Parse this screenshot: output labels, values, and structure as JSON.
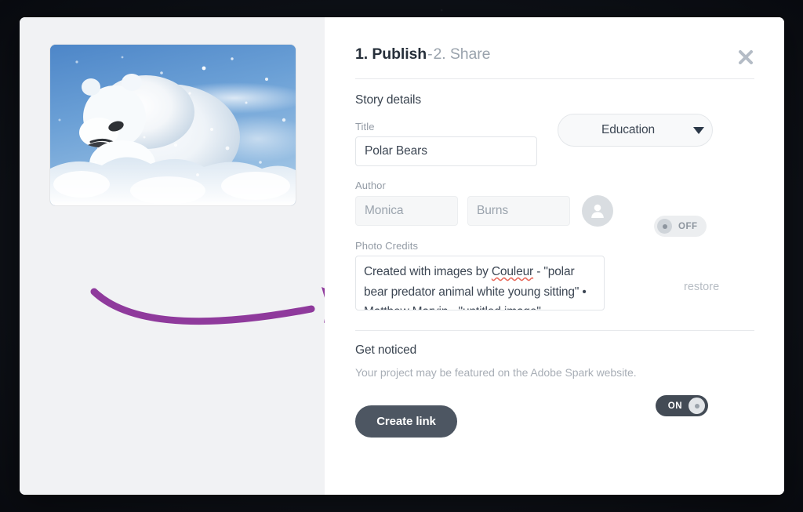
{
  "backdrop": {
    "color": "#0e1117"
  },
  "dialog": {
    "accent_purple": "#8f3a9c",
    "close_icon": "close-x-icon"
  },
  "preview": {
    "image_alt": "Polar bear cub lying in blowing snow under a blue sky",
    "annotation": {
      "type": "curved-arrow",
      "color": "#8f3a9c",
      "points_to": "photo-credits-field"
    }
  },
  "header": {
    "step_current": "1. Publish",
    "separator": "-",
    "step_next": "2. Share"
  },
  "story_details": {
    "section_title": "Story details",
    "title_label": "Title",
    "title_value": "Polar Bears",
    "title_placeholder": "Title",
    "category": {
      "selected": "Education",
      "caret_icon": "chevron-down-icon"
    },
    "author_label": "Author",
    "author_first_placeholder": "Monica",
    "author_first_value": "",
    "author_last_placeholder": "Burns",
    "author_last_value": "",
    "avatar_icon": "person-avatar-icon",
    "author_toggle": {
      "state": "off",
      "label": "OFF"
    },
    "credits_label": "Photo Credits",
    "credits_line1_a": "Created with images by ",
    "credits_line1_misspelled": "Couleur",
    "credits_line1_b": " - \"polar",
    "credits_line2": "bear predator animal white young sitting\"",
    "credits_line3": "• Matthew Marvin - \"untitled image\"",
    "restore_label": "restore"
  },
  "get_noticed": {
    "section_title": "Get noticed",
    "description": "Your project may be featured on the Adobe Spark website.",
    "feature_toggle": {
      "state": "on",
      "label": "ON"
    }
  },
  "actions": {
    "create_link_label": "Create link"
  }
}
